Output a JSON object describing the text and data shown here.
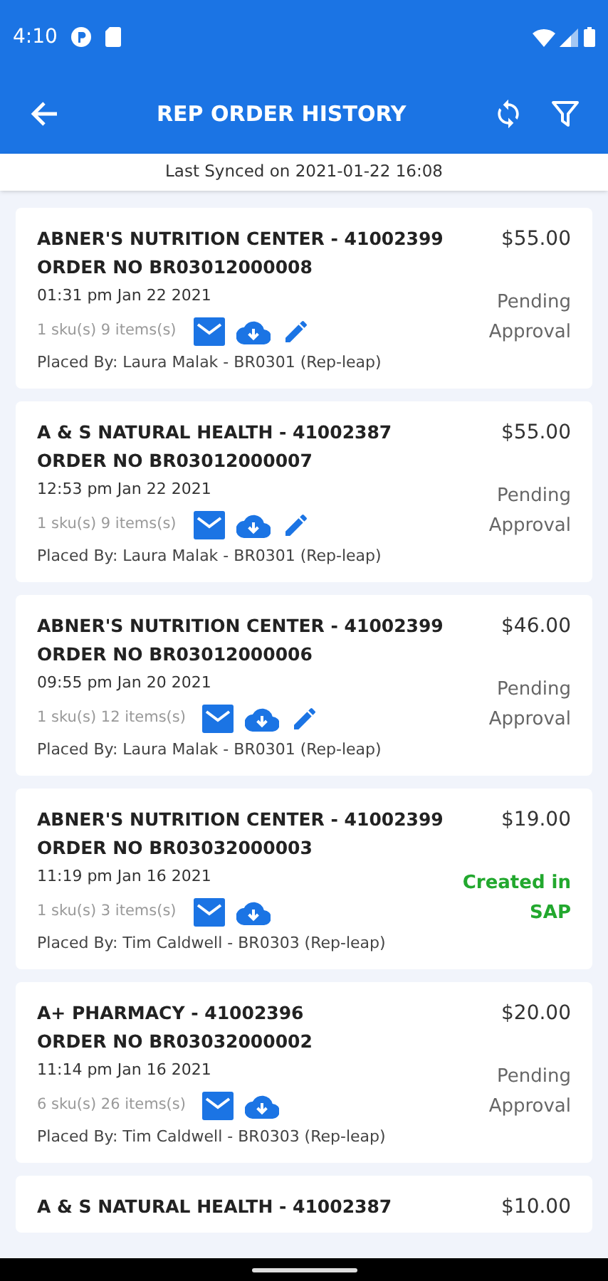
{
  "status_bar": {
    "time": "4:10"
  },
  "app_bar": {
    "title": "REP ORDER HISTORY"
  },
  "sync_note": "Last Synced on 2021-01-22 16:08",
  "orders": [
    {
      "customer": "ABNER'S NUTRITION CENTER - 41002399",
      "order_no": "ORDER NO BR03012000008",
      "date": "01:31 pm Jan 22 2021",
      "counts": "1 sku(s) 9 items(s)",
      "placed_by": "Placed By: Laura Malak - BR0301 (Rep-leap)",
      "amount": "$55.00",
      "status": "Pending Approval",
      "kind": "pending",
      "editable": true
    },
    {
      "customer": "A & S NATURAL HEALTH - 41002387",
      "order_no": "ORDER NO BR03012000007",
      "date": "12:53 pm Jan 22 2021",
      "counts": "1 sku(s) 9 items(s)",
      "placed_by": "Placed By: Laura Malak - BR0301 (Rep-leap)",
      "amount": "$55.00",
      "status": "Pending Approval",
      "kind": "pending",
      "editable": true
    },
    {
      "customer": "ABNER'S NUTRITION CENTER - 41002399",
      "order_no": "ORDER NO BR03012000006",
      "date": "09:55 pm Jan 20 2021",
      "counts": "1 sku(s) 12 items(s)",
      "placed_by": "Placed By: Laura Malak - BR0301 (Rep-leap)",
      "amount": "$46.00",
      "status": "Pending Approval",
      "kind": "pending",
      "editable": true
    },
    {
      "customer": "ABNER'S NUTRITION CENTER - 41002399",
      "order_no": "ORDER NO BR03032000003",
      "date": "11:19 pm Jan 16 2021",
      "counts": "1 sku(s) 3 items(s)",
      "placed_by": "Placed By: Tim Caldwell - BR0303 (Rep-leap)",
      "amount": "$19.00",
      "status": "Created in SAP",
      "kind": "created",
      "editable": false
    },
    {
      "customer": "A+ PHARMACY - 41002396",
      "order_no": "ORDER NO BR03032000002",
      "date": "11:14 pm Jan 16 2021",
      "counts": "6 sku(s) 26 items(s)",
      "placed_by": "Placed By: Tim Caldwell - BR0303 (Rep-leap)",
      "amount": "$20.00",
      "status": "Pending Approval",
      "kind": "pending",
      "editable": false
    },
    {
      "customer": "A & S NATURAL HEALTH - 41002387",
      "amount": "$10.00"
    }
  ]
}
